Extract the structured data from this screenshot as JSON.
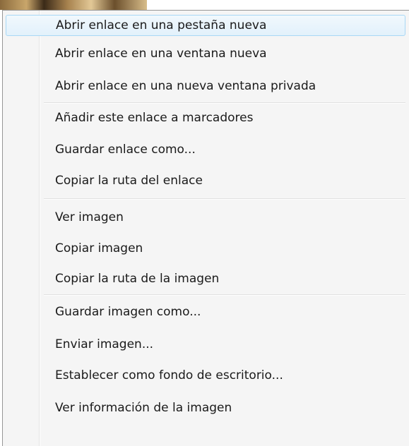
{
  "context_menu": {
    "groups": [
      {
        "items": [
          {
            "label": "Abrir enlace en una pestaña nueva",
            "highlighted": true
          },
          {
            "label": "Abrir enlace en una ventana nueva"
          },
          {
            "label": "Abrir enlace en una nueva ventana privada"
          }
        ]
      },
      {
        "items": [
          {
            "label": "Añadir este enlace a marcadores"
          },
          {
            "label": "Guardar enlace como..."
          },
          {
            "label": "Copiar la ruta del enlace"
          }
        ]
      },
      {
        "items": [
          {
            "label": "Ver imagen"
          },
          {
            "label": "Copiar imagen"
          },
          {
            "label": "Copiar la ruta de la imagen"
          }
        ]
      },
      {
        "items": [
          {
            "label": "Guardar imagen como..."
          },
          {
            "label": "Enviar imagen..."
          },
          {
            "label": "Establecer como fondo de escritorio..."
          },
          {
            "label": "Ver información de la imagen"
          }
        ]
      }
    ]
  }
}
